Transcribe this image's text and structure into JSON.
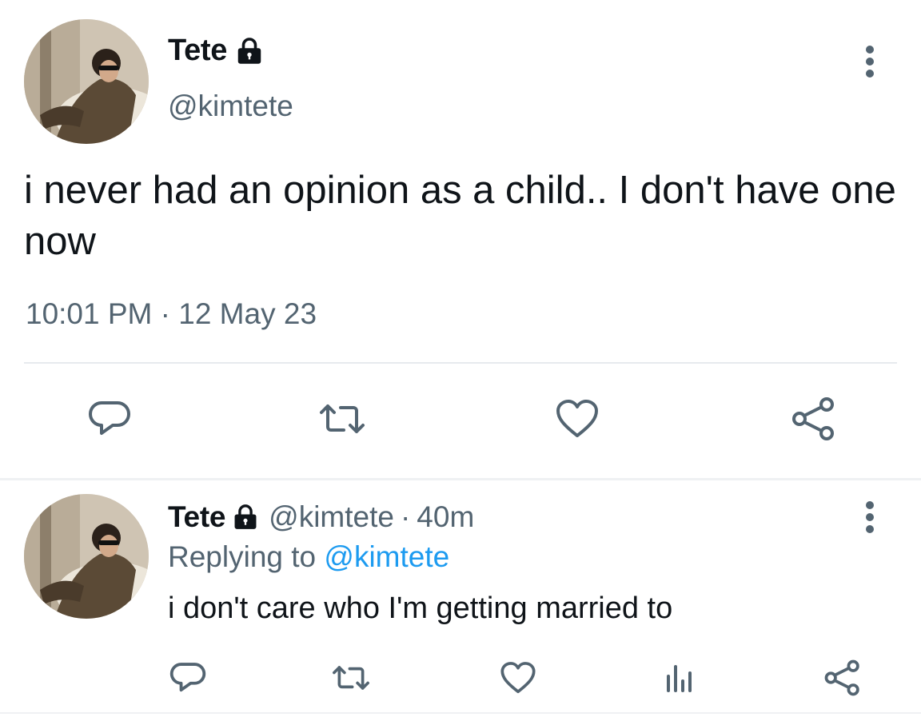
{
  "main_tweet": {
    "author_name": "Tete",
    "author_handle": "@kimtete",
    "text": "i never had an opinion as a child.. I don't have one now",
    "timestamp": "10:01 PM · 12 May 23",
    "icons": [
      "lock-icon",
      "more-icon",
      "reply-icon",
      "retweet-icon",
      "like-icon",
      "share-icon"
    ]
  },
  "reply_tweet": {
    "author_name": "Tete",
    "author_handle": "@kimtete",
    "separator": "·",
    "age": "40m",
    "replying_prefix": "Replying to",
    "replying_to": "@kimtete",
    "text": "i don't care who I'm getting married to",
    "icons": [
      "lock-icon",
      "more-icon",
      "reply-icon",
      "retweet-icon",
      "like-icon",
      "views-icon",
      "share-icon"
    ]
  },
  "colors": {
    "text_primary": "#0f1419",
    "text_secondary": "#536471",
    "mention": "#1d9bf0",
    "divider": "#e7eaee"
  }
}
